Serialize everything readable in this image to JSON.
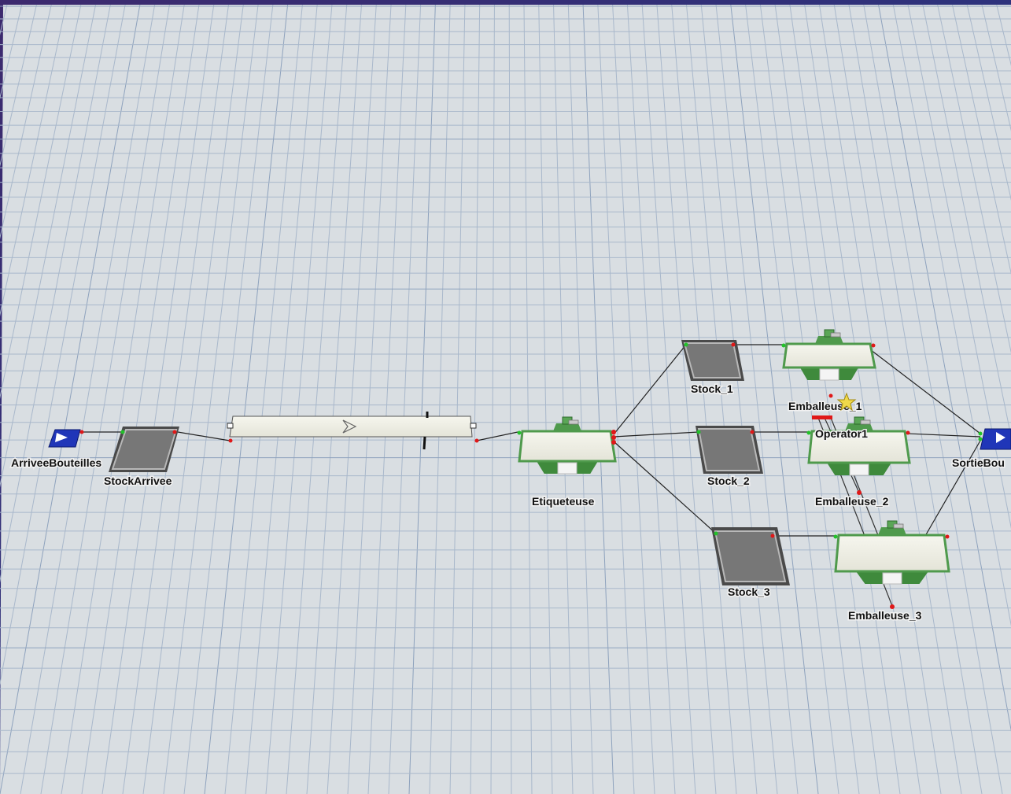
{
  "model": {
    "objects": [
      {
        "id": "source",
        "label": "ArriveeBouteilles",
        "kind": "source"
      },
      {
        "id": "queue_in",
        "label": "StockArrivee",
        "kind": "queue"
      },
      {
        "id": "conveyor",
        "label": "",
        "kind": "conveyor"
      },
      {
        "id": "labeler",
        "label": "Etiqueteuse",
        "kind": "processor"
      },
      {
        "id": "stock1",
        "label": "Stock_1",
        "kind": "queue"
      },
      {
        "id": "stock2",
        "label": "Stock_2",
        "kind": "queue"
      },
      {
        "id": "stock3",
        "label": "Stock_3",
        "kind": "queue"
      },
      {
        "id": "pack1",
        "label": "Emballeuse_1",
        "kind": "processor"
      },
      {
        "id": "pack2",
        "label": "Emballeuse_2",
        "kind": "processor"
      },
      {
        "id": "pack3",
        "label": "Emballeuse_3",
        "kind": "processor"
      },
      {
        "id": "operator",
        "label": "Operator1",
        "kind": "operator"
      },
      {
        "id": "sink",
        "label": "SortieBou",
        "kind": "sink"
      }
    ]
  },
  "colors": {
    "floor": "#d9dee2",
    "grid": "#9fb0c6",
    "frame": "#3a3f8a",
    "machine_green": "#4f9a4c",
    "queue_gray": "#6b6b6b",
    "port_red": "#e01818",
    "port_green": "#22c22a",
    "source_blue": "#2036b8"
  },
  "icons": [
    "conveyor-arrow-icon",
    "source-flag-icon",
    "sink-flag-icon",
    "operator-star-icon"
  ]
}
